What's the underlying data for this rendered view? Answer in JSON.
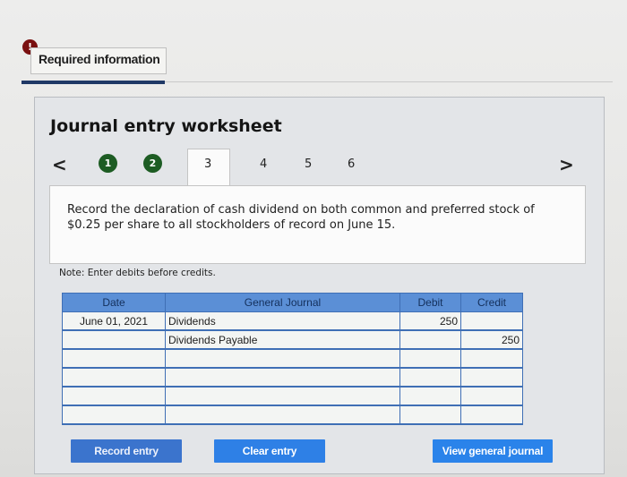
{
  "header": {
    "required_info_label": "Required information",
    "alert_icon": "exclamation-icon"
  },
  "worksheet": {
    "title": "Journal entry worksheet",
    "nav": {
      "prev_icon": "chevron-left-icon",
      "next_icon": "chevron-right-icon",
      "prev_glyph": "<",
      "next_glyph": ">"
    },
    "steps": [
      {
        "label": "1",
        "state": "done"
      },
      {
        "label": "2",
        "state": "done"
      },
      {
        "label": "3",
        "state": "active"
      },
      {
        "label": "4",
        "state": "pending"
      },
      {
        "label": "5",
        "state": "pending"
      },
      {
        "label": "6",
        "state": "pending"
      }
    ],
    "instruction": "Record the declaration of cash dividend on both common and preferred stock of $0.25 per share to all stockholders of record on June 15.",
    "note": "Note: Enter debits before credits."
  },
  "journal": {
    "columns": [
      "Date",
      "General Journal",
      "Debit",
      "Credit"
    ],
    "rows": [
      {
        "date": "June 01, 2021",
        "account": "Dividends",
        "debit": "250",
        "credit": ""
      },
      {
        "date": "",
        "account": "Dividends Payable",
        "debit": "",
        "credit": "250"
      },
      {
        "date": "",
        "account": "",
        "debit": "",
        "credit": ""
      },
      {
        "date": "",
        "account": "",
        "debit": "",
        "credit": ""
      },
      {
        "date": "",
        "account": "",
        "debit": "",
        "credit": ""
      },
      {
        "date": "",
        "account": "",
        "debit": "",
        "credit": ""
      }
    ]
  },
  "buttons": {
    "record": "Record entry",
    "clear": "Clear entry",
    "view": "View general journal"
  },
  "colors": {
    "step_done": "#1d5c23",
    "header_blue": "#5b8fd6",
    "button_blue": "#2e80e6",
    "accent_bar": "#1f3866"
  }
}
